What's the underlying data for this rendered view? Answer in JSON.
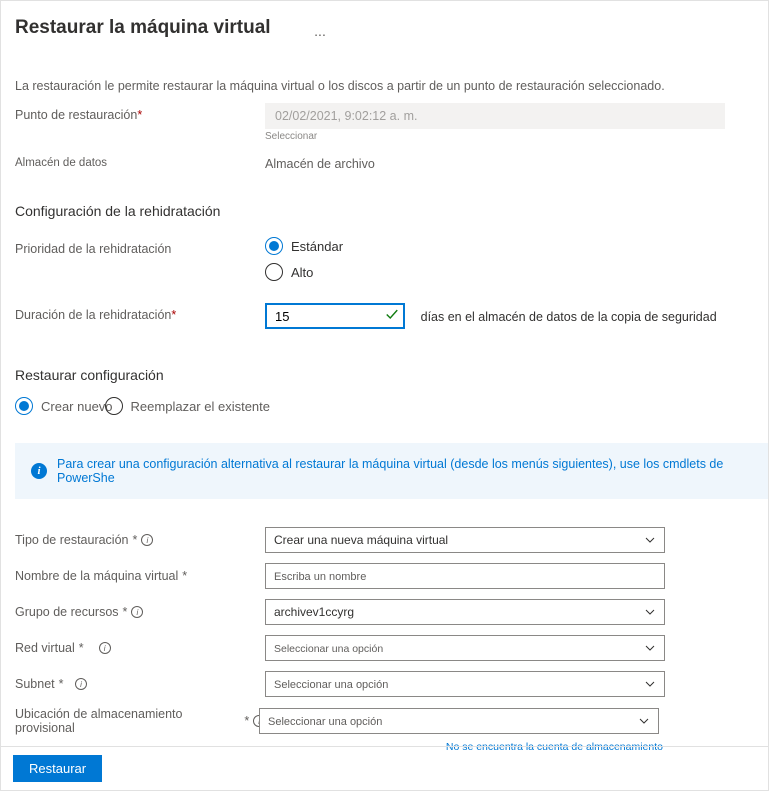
{
  "header": {
    "title": "Restaurar la máquina virtual",
    "more": "..."
  },
  "description": "La restauración le permite restaurar la máquina virtual o los discos a partir de un punto de restauración seleccionado.",
  "restorePoint": {
    "label": "Punto de restauración",
    "value": "02/02/2021, 9:02:12 a. m.",
    "selectLink": "Seleccionar"
  },
  "dataStore": {
    "label": "Almacén de datos",
    "value": "Almacén de archivo"
  },
  "rehydration": {
    "sectionTitle": "Configuración de la rehidratación",
    "priority": {
      "label": "Prioridad de la rehidratación",
      "options": {
        "standard": "Estándar",
        "high": "Alto"
      },
      "selected": "standard"
    },
    "duration": {
      "label": "Duración de la rehidratación",
      "value": "15",
      "suffix": "días en el almacén de datos de la copia de seguridad"
    }
  },
  "restoreConfig": {
    "sectionTitle": "Restaurar configuración",
    "mode": {
      "createNew": "Crear nuevo",
      "replace": "Reemplazar el existente",
      "selected": "createNew"
    },
    "banner": "Para crear una configuración alternativa al restaurar la máquina virtual (desde los menús siguientes), use los cmdlets de PowerShe",
    "fields": {
      "restoreType": {
        "label": "Tipo de restauración",
        "value": "Crear una nueva máquina virtual"
      },
      "vmName": {
        "label": "Nombre de la máquina virtual",
        "placeholder": "Escriba un nombre"
      },
      "resourceGroup": {
        "label": "Grupo de recursos",
        "value": "archivev1ccyrg"
      },
      "vnet": {
        "label": "Red virtual",
        "placeholder": "Seleccionar una opción"
      },
      "subnet": {
        "label": "Subnet",
        "placeholder": "Seleccionar una opción"
      },
      "staging": {
        "label": "Ubicación de almacenamiento provisional",
        "placeholder": "Seleccionar una opción"
      }
    },
    "noAccountLink": "No se encuentra la cuenta de almacenamiento"
  },
  "footer": {
    "restore": "Restaurar"
  },
  "req": "*"
}
